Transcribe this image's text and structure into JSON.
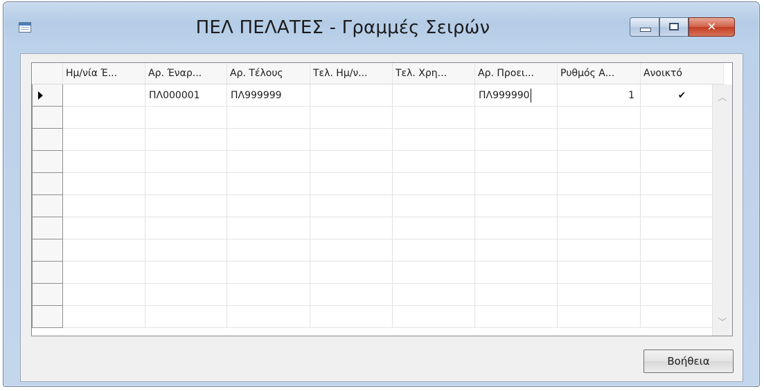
{
  "window": {
    "title": "ΠΕΛ ΠΕΛΑΤΕΣ - Γραμμές Σειρών",
    "app_icon": "table-form-icon",
    "controls": {
      "minimize_icon": "minimize-icon",
      "maximize_icon": "maximize-icon",
      "close_icon": "close-icon",
      "close_glyph": "✕"
    }
  },
  "grid": {
    "columns": [
      "Ημ/νία Έ...",
      "Αρ. Έναρ...",
      "Αρ. Τέλους",
      "Τελ. Ημ/ν...",
      "Τελ. Χρη...",
      "Αρ. Προει...",
      "Ρυθμός Α...",
      "Ανοικτό"
    ],
    "rows": [
      {
        "selected": true,
        "cells": [
          "",
          "ΠΛ000001",
          "ΠΛ999999",
          "",
          "",
          "ΠΛ999990",
          "1",
          "✔"
        ]
      }
    ],
    "empty_row_count": 10,
    "scroll_up_glyph": "︿",
    "scroll_down_glyph": "﹀"
  },
  "buttons": {
    "help": "Βοήθεια"
  }
}
